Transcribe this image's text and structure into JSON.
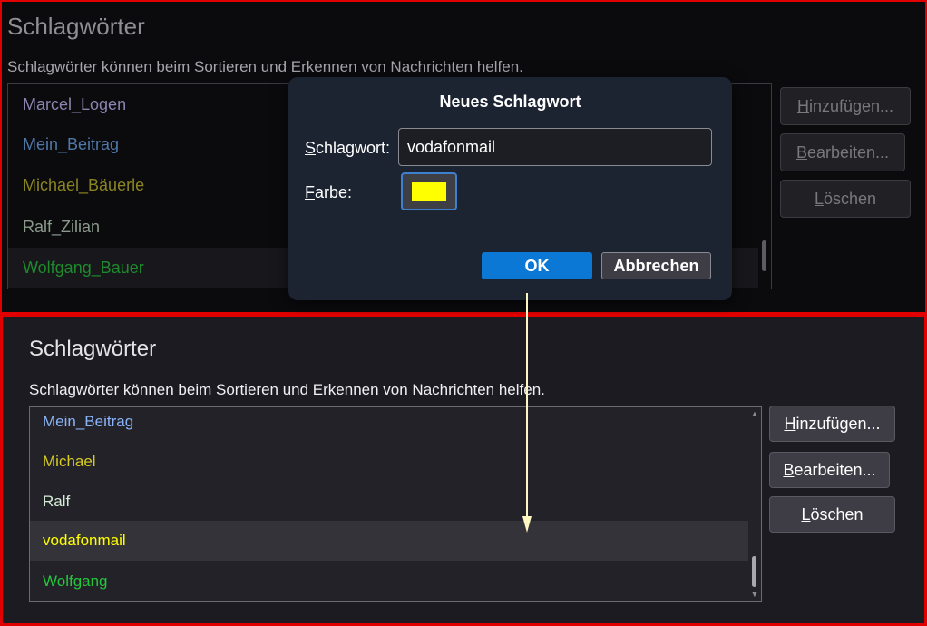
{
  "top_panel": {
    "title": "Schlagwörter",
    "description": "Schlagwörter können beim Sortieren und Erkennen von Nachrichten helfen.",
    "tags": [
      {
        "label": "Marcel_Logen",
        "color": "#8a86b0"
      },
      {
        "label": "Mein_Beitrag",
        "color": "#4f78a8"
      },
      {
        "label": "Michael_Bäuerle",
        "color": "#8a8520"
      },
      {
        "label": "Ralf_Zilian",
        "color": "#8a9a8a"
      },
      {
        "label": "Wolfgang_Bauer",
        "color": "#1e8a2c",
        "selected": true
      }
    ],
    "buttons": {
      "add": {
        "access": "H",
        "rest": "inzufügen..."
      },
      "edit": {
        "access": "B",
        "rest": "earbeiten..."
      },
      "delete": {
        "access": "L",
        "rest": "öschen"
      }
    }
  },
  "dialog": {
    "title": "Neues Schlagwort",
    "tag_label": {
      "access": "S",
      "rest": "chlagwort:"
    },
    "tag_value": "vodafonmail",
    "color_label": {
      "access": "F",
      "rest": "arbe:"
    },
    "color_value": "#ffff00",
    "ok_label": "OK",
    "cancel_label": "Abbrechen"
  },
  "bottom_panel": {
    "title": "Schlagwörter",
    "description": "Schlagwörter können beim Sortieren und Erkennen von Nachrichten helfen.",
    "tags": [
      {
        "label": "Mein_Beitrag",
        "color": "#8ab4f8"
      },
      {
        "label": "Michael",
        "color": "#d8cc20"
      },
      {
        "label": "Ralf",
        "color": "#d4ecd4"
      },
      {
        "label": "vodafonmail",
        "color": "#ffff00",
        "selected": true
      },
      {
        "label": "Wolfgang",
        "color": "#22c83a"
      }
    ],
    "buttons": {
      "add": {
        "access": "H",
        "rest": "inzufügen..."
      },
      "edit": {
        "access": "B",
        "rest": "earbeiten..."
      },
      "delete": {
        "access": "L",
        "rest": "öschen"
      }
    }
  },
  "annotation": {
    "arrow_color": "#fff7c2",
    "border_color": "#e00000"
  }
}
